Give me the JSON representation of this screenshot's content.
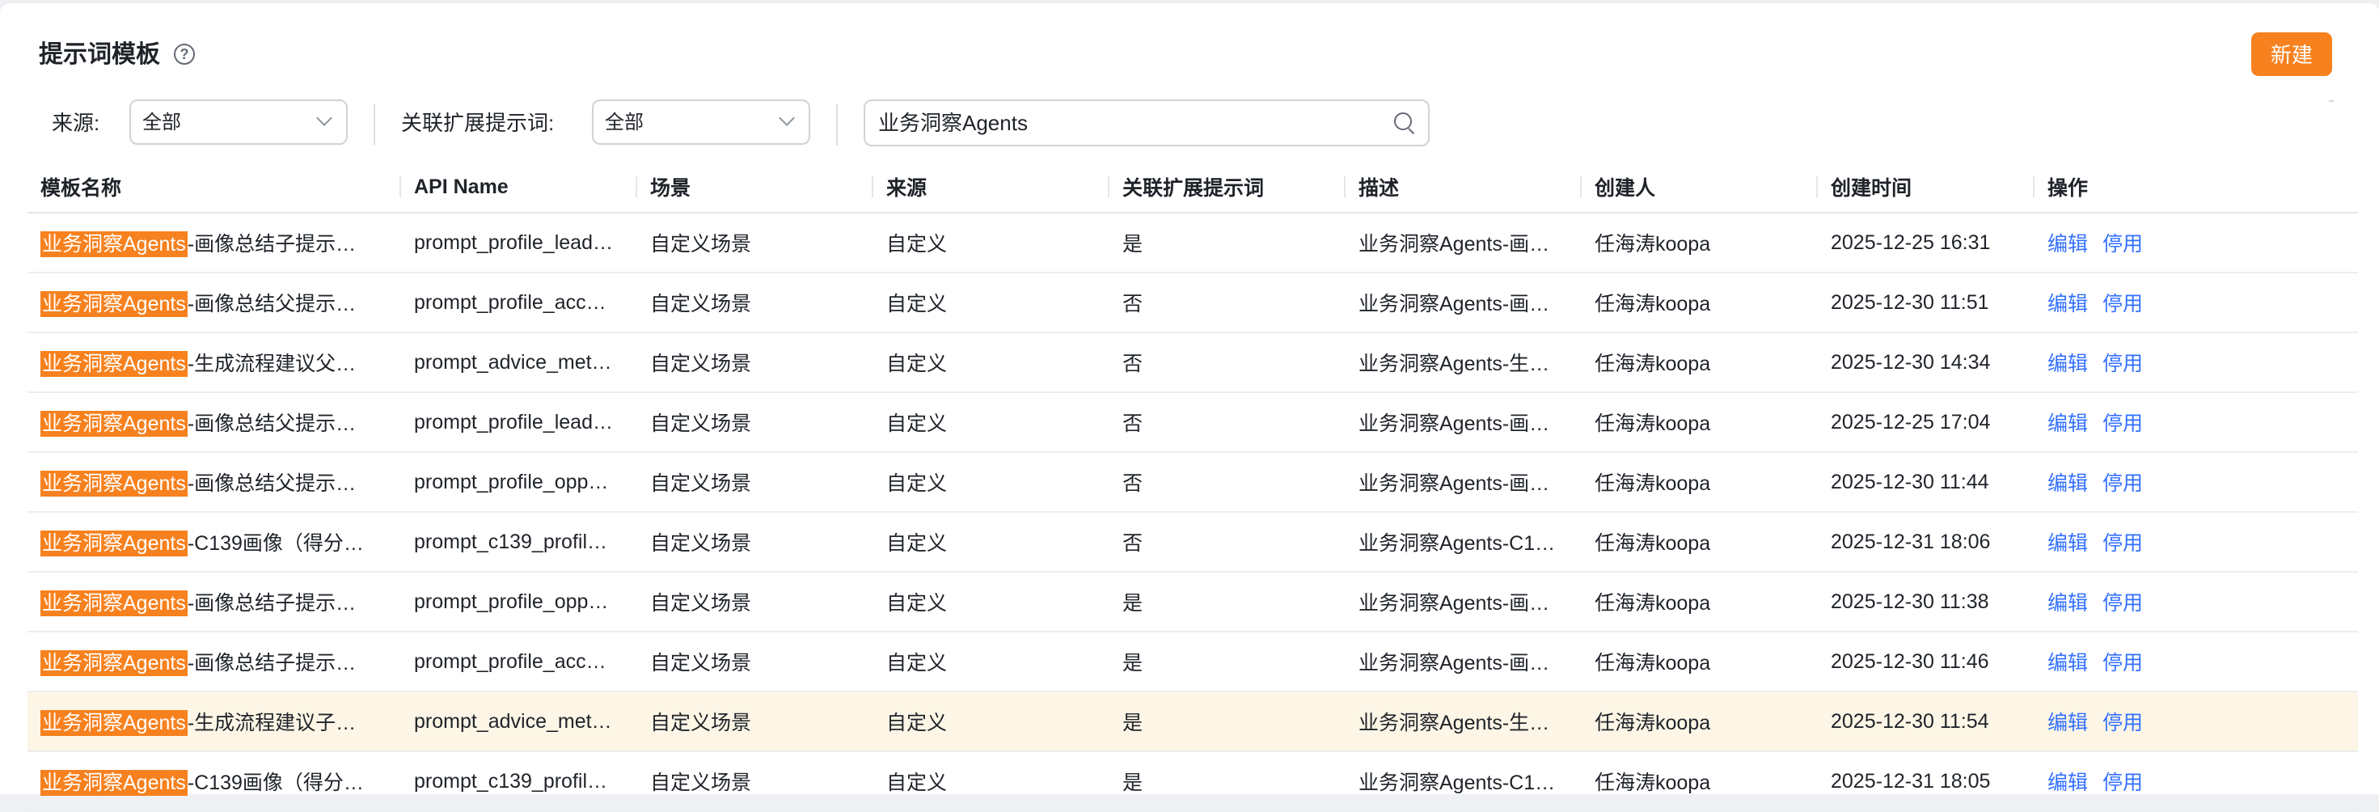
{
  "header": {
    "title": "提示词模板",
    "help_icon": "question-circle-icon",
    "new_button": "新建"
  },
  "filters": {
    "source_label": "来源:",
    "source_value": "全部",
    "ext_label": "关联扩展提示词:",
    "ext_value": "全部",
    "search_value": "业务洞察Agents",
    "search_icon": "search-icon"
  },
  "colors": {
    "accent": "#f7811e",
    "link": "#3370ff",
    "highlight_row": "#fdf6e6"
  },
  "table": {
    "columns": [
      "模板名称",
      "API Name",
      "场景",
      "来源",
      "关联扩展提示词",
      "描述",
      "创建人",
      "创建时间",
      "操作"
    ],
    "rows": [
      {
        "match": "业务洞察Agents",
        "rest": "-画像总结子提示…",
        "api": "prompt_profile_lead…",
        "scene": "自定义场景",
        "source": "自定义",
        "ext": "是",
        "desc": "业务洞察Agents-画…",
        "creator": "任海涛koopa",
        "time": "2025-12-25 16:31",
        "op1": "编辑",
        "op2": "停用"
      },
      {
        "match": "业务洞察Agents",
        "rest": "-画像总结父提示…",
        "api": "prompt_profile_acc…",
        "scene": "自定义场景",
        "source": "自定义",
        "ext": "否",
        "desc": "业务洞察Agents-画…",
        "creator": "任海涛koopa",
        "time": "2025-12-30 11:51",
        "op1": "编辑",
        "op2": "停用"
      },
      {
        "match": "业务洞察Agents",
        "rest": "-生成流程建议父…",
        "api": "prompt_advice_met…",
        "scene": "自定义场景",
        "source": "自定义",
        "ext": "否",
        "desc": "业务洞察Agents-生…",
        "creator": "任海涛koopa",
        "time": "2025-12-30 14:34",
        "op1": "编辑",
        "op2": "停用"
      },
      {
        "match": "业务洞察Agents",
        "rest": "-画像总结父提示…",
        "api": "prompt_profile_lead…",
        "scene": "自定义场景",
        "source": "自定义",
        "ext": "否",
        "desc": "业务洞察Agents-画…",
        "creator": "任海涛koopa",
        "time": "2025-12-25 17:04",
        "op1": "编辑",
        "op2": "停用"
      },
      {
        "match": "业务洞察Agents",
        "rest": "-画像总结父提示…",
        "api": "prompt_profile_opp…",
        "scene": "自定义场景",
        "source": "自定义",
        "ext": "否",
        "desc": "业务洞察Agents-画…",
        "creator": "任海涛koopa",
        "time": "2025-12-30 11:44",
        "op1": "编辑",
        "op2": "停用"
      },
      {
        "match": "业务洞察Agents",
        "rest": "-C139画像（得分…",
        "api": "prompt_c139_profil…",
        "scene": "自定义场景",
        "source": "自定义",
        "ext": "否",
        "desc": "业务洞察Agents-C1…",
        "creator": "任海涛koopa",
        "time": "2025-12-31 18:06",
        "op1": "编辑",
        "op2": "停用"
      },
      {
        "match": "业务洞察Agents",
        "rest": "-画像总结子提示…",
        "api": "prompt_profile_opp…",
        "scene": "自定义场景",
        "source": "自定义",
        "ext": "是",
        "desc": "业务洞察Agents-画…",
        "creator": "任海涛koopa",
        "time": "2025-12-30 11:38",
        "op1": "编辑",
        "op2": "停用"
      },
      {
        "match": "业务洞察Agents",
        "rest": "-画像总结子提示…",
        "api": "prompt_profile_acc…",
        "scene": "自定义场景",
        "source": "自定义",
        "ext": "是",
        "desc": "业务洞察Agents-画…",
        "creator": "任海涛koopa",
        "time": "2025-12-30 11:46",
        "op1": "编辑",
        "op2": "停用"
      },
      {
        "match": "业务洞察Agents",
        "rest": "-生成流程建议子…",
        "api": "prompt_advice_met…",
        "scene": "自定义场景",
        "source": "自定义",
        "ext": "是",
        "desc": "业务洞察Agents-生…",
        "creator": "任海涛koopa",
        "time": "2025-12-30 11:54",
        "op1": "编辑",
        "op2": "停用",
        "highlighted": true
      },
      {
        "match": "业务洞察Agents",
        "rest": "-C139画像（得分…",
        "api": "prompt_c139_profil…",
        "scene": "自定义场景",
        "source": "自定义",
        "ext": "是",
        "desc": "业务洞察Agents-C1…",
        "creator": "任海涛koopa",
        "time": "2025-12-31 18:05",
        "op1": "编辑",
        "op2": "停用"
      }
    ]
  }
}
